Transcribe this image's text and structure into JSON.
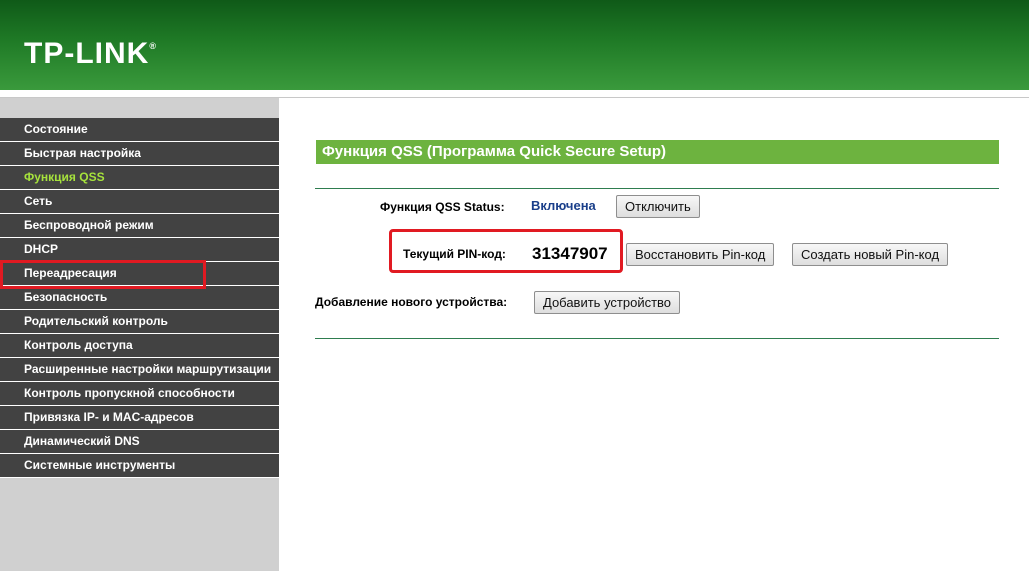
{
  "brand": {
    "logo_text": "TP-LINK",
    "trademark": "®",
    "accent_color": "#6db33f",
    "highlight_color": "#e11a22"
  },
  "sidebar": {
    "items": [
      {
        "label": "Состояние",
        "active": false
      },
      {
        "label": "Быстрая настройка",
        "active": false
      },
      {
        "label": "Функция QSS",
        "active": true
      },
      {
        "label": "Сеть",
        "active": false
      },
      {
        "label": "Беспроводной режим",
        "active": false
      },
      {
        "label": "DHCP",
        "active": false
      },
      {
        "label": "Переадресация",
        "active": false
      },
      {
        "label": "Безопасность",
        "active": false
      },
      {
        "label": "Родительский контроль",
        "active": false
      },
      {
        "label": "Контроль доступа",
        "active": false
      },
      {
        "label": "Расширенные настройки маршрутизации",
        "active": false
      },
      {
        "label": "Контроль пропускной способности",
        "active": false
      },
      {
        "label": "Привязка IP- и MAC-адресов",
        "active": false
      },
      {
        "label": "Динамический DNS",
        "active": false
      },
      {
        "label": "Системные инструменты",
        "active": false
      }
    ]
  },
  "main": {
    "title": "Функция QSS (Программа Quick Secure Setup)",
    "qss_status": {
      "label": "Функция QSS Status:",
      "value": "Включена",
      "button": "Отключить"
    },
    "pin": {
      "label": "Текущий PIN-код:",
      "value": "31347907",
      "restore_button": "Восстановить Pin-код",
      "generate_button": "Создать новый Pin-код"
    },
    "add_device": {
      "label": "Добавление нового устройства:",
      "button": "Добавить устройство"
    }
  }
}
